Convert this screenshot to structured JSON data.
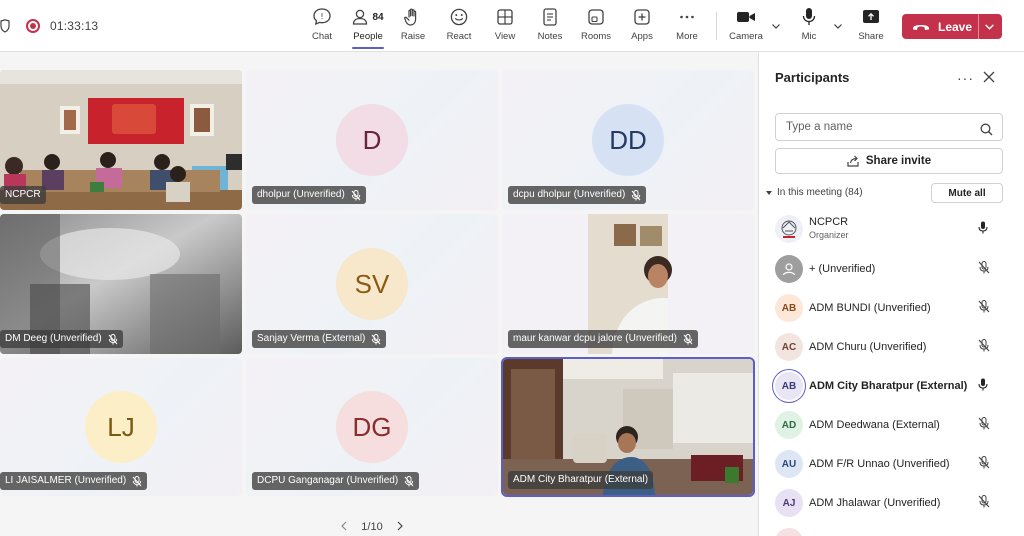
{
  "toolbar": {
    "timer": "01:33:13",
    "chat": "Chat",
    "people": "People",
    "people_count": "84",
    "raise": "Raise",
    "react": "React",
    "view": "View",
    "notes": "Notes",
    "rooms": "Rooms",
    "apps": "Apps",
    "more": "More",
    "camera": "Camera",
    "mic": "Mic",
    "share": "Share",
    "leave": "Leave",
    "leave_color": "#c4314b",
    "accent": "#5b5fc7"
  },
  "grid": {
    "tiles": [
      {
        "name": "NCPCR",
        "type": "video"
      },
      {
        "name": "dholpur (Unverified)",
        "initials": "D",
        "avatar_bg": "#f2dce6",
        "avatar_fg": "#6b2340"
      },
      {
        "name": "dcpu dholpur (Unverified)",
        "initials": "DD",
        "avatar_bg": "#d6e2f3",
        "avatar_fg": "#243a64"
      },
      {
        "name": "DM Deeg (Unverified)",
        "type": "video"
      },
      {
        "name": "Sanjay Verma (External)",
        "initials": "SV",
        "avatar_bg": "#f7e8cc",
        "avatar_fg": "#8a5a12"
      },
      {
        "name": "maur kanwar dcpu jalore (Unverified)",
        "type": "video"
      },
      {
        "name": "LI JAISALMER (Unverified)",
        "initials": "LJ",
        "avatar_bg": "#fcefc8",
        "avatar_fg": "#7a5810"
      },
      {
        "name": "DCPU Ganganagar (Unverified)",
        "initials": "DG",
        "avatar_bg": "#f6dede",
        "avatar_fg": "#8a2d2d"
      },
      {
        "name": "ADM City Bharatpur (External)",
        "type": "video"
      }
    ],
    "pager": "1/10"
  },
  "panel": {
    "title": "Participants",
    "search_placeholder": "Type a name",
    "share_invite": "Share invite",
    "in_meeting": "In this meeting (84)",
    "mute_all": "Mute all",
    "participants": [
      {
        "name": "NCPCR",
        "sub": "Organizer",
        "initials": "",
        "bg": "#eef0f7",
        "fg": "#5b5fc7",
        "mic": "on"
      },
      {
        "name": "+ (Unverified)",
        "initials": "",
        "bg": "#9e9e9e",
        "fg": "#ffffff",
        "mic": "muted"
      },
      {
        "name": "ADM BUNDI (Unverified)",
        "initials": "AB",
        "bg": "#fde7d9",
        "fg": "#8a4a1c",
        "mic": "muted"
      },
      {
        "name": "ADM Churu (Unverified)",
        "initials": "AC",
        "bg": "#f2e4df",
        "fg": "#6e4334",
        "mic": "muted"
      },
      {
        "name": "ADM City Bharatpur (External)",
        "initials": "AB",
        "bg": "#e8e6f5",
        "fg": "#3d3a7a",
        "mic": "on",
        "bold": true
      },
      {
        "name": "ADM Deedwana (External)",
        "initials": "AD",
        "bg": "#dff2e5",
        "fg": "#2f6b41",
        "mic": "muted"
      },
      {
        "name": "ADM F/R Unnao (Unverified)",
        "initials": "AU",
        "bg": "#dce6f5",
        "fg": "#2e4a78",
        "mic": "muted"
      },
      {
        "name": "ADM Jhalawar (Unverified)",
        "initials": "AJ",
        "bg": "#e7e1f3",
        "fg": "#4d3a78",
        "mic": "muted"
      }
    ]
  }
}
